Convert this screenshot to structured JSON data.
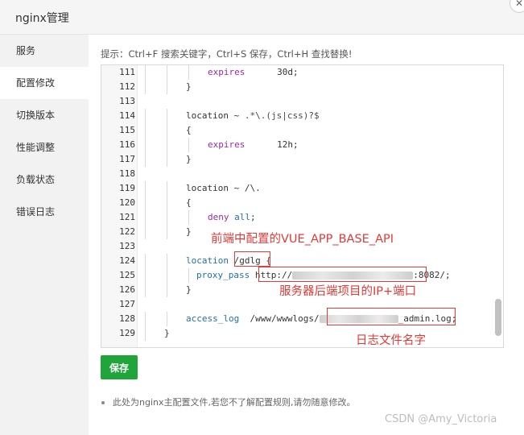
{
  "window": {
    "title": "nginx管理",
    "close_glyph": "✕"
  },
  "sidebar": {
    "items": [
      {
        "label": "服务"
      },
      {
        "label": "配置修改"
      },
      {
        "label": "切换版本"
      },
      {
        "label": "性能调整"
      },
      {
        "label": "负载状态"
      },
      {
        "label": "错误日志"
      }
    ],
    "active_index": 1
  },
  "hint": "提示：Ctrl+F 搜索关键字，Ctrl+S 保存，Ctrl+H 查找替换!",
  "editor": {
    "lines": [
      {
        "n": "111",
        "indent": 3,
        "parts": [
          [
            "dir",
            "expires"
          ],
          [
            "plain",
            "      30d;"
          ]
        ]
      },
      {
        "n": "112",
        "indent": 2,
        "parts": [
          [
            "plain",
            "}"
          ]
        ]
      },
      {
        "n": "113",
        "indent": 0,
        "parts": []
      },
      {
        "n": "114",
        "indent": 2,
        "parts": [
          [
            "plain",
            "location ~ "
          ],
          [
            "re",
            ".*\\.(js|css)?$"
          ]
        ]
      },
      {
        "n": "115",
        "indent": 2,
        "parts": [
          [
            "plain",
            "{"
          ]
        ]
      },
      {
        "n": "116",
        "indent": 3,
        "parts": [
          [
            "dir",
            "expires"
          ],
          [
            "plain",
            "      12h;"
          ]
        ]
      },
      {
        "n": "117",
        "indent": 2,
        "parts": [
          [
            "plain",
            "}"
          ]
        ]
      },
      {
        "n": "118",
        "indent": 0,
        "parts": []
      },
      {
        "n": "119",
        "indent": 2,
        "parts": [
          [
            "plain",
            "location ~ /\\."
          ]
        ]
      },
      {
        "n": "120",
        "indent": 2,
        "parts": [
          [
            "plain",
            "{"
          ]
        ]
      },
      {
        "n": "121",
        "indent": 3,
        "parts": [
          [
            "dir",
            "deny"
          ],
          [
            "plain",
            " "
          ],
          [
            "blue",
            "all"
          ],
          [
            "plain",
            ";"
          ]
        ]
      },
      {
        "n": "122",
        "indent": 2,
        "parts": [
          [
            "plain",
            "}"
          ]
        ]
      },
      {
        "n": "123",
        "indent": 0,
        "parts": []
      },
      {
        "n": "124",
        "indent": 2,
        "parts": [
          [
            "blue",
            "location"
          ],
          [
            "plain",
            " /gdlg {"
          ]
        ]
      },
      {
        "n": "125",
        "indent": 2,
        "extra": true,
        "parts": [
          [
            "blue",
            "proxy_pass"
          ],
          [
            "plain",
            " http://"
          ],
          [
            "blur",
            "w"
          ],
          [
            "plain",
            ":8082/;"
          ]
        ]
      },
      {
        "n": "126",
        "indent": 2,
        "parts": [
          [
            "plain",
            "}"
          ]
        ]
      },
      {
        "n": "127",
        "indent": 0,
        "parts": []
      },
      {
        "n": "128",
        "indent": 2,
        "parts": [
          [
            "blue",
            "access_log"
          ],
          [
            "plain",
            "  /www/wwwlogs/"
          ],
          [
            "blur",
            "s"
          ],
          [
            "plain",
            "_admin.log;"
          ]
        ]
      },
      {
        "n": "129",
        "indent": 1,
        "parts": [
          [
            "plain",
            "}"
          ]
        ]
      }
    ]
  },
  "annotations": {
    "vue_api": "前端中配置的VUE_APP_BASE_API",
    "ip_port": "服务器后端项目的IP+端口",
    "log_name": "日志文件名字"
  },
  "save_button": "保存",
  "note": "此处为nginx主配置文件,若您不了解配置规则,请勿随意修改。",
  "watermark": "CSDN @Amy_Victoria",
  "colors": {
    "accent_green": "#20a53a",
    "annotation_red": "#e53935"
  }
}
